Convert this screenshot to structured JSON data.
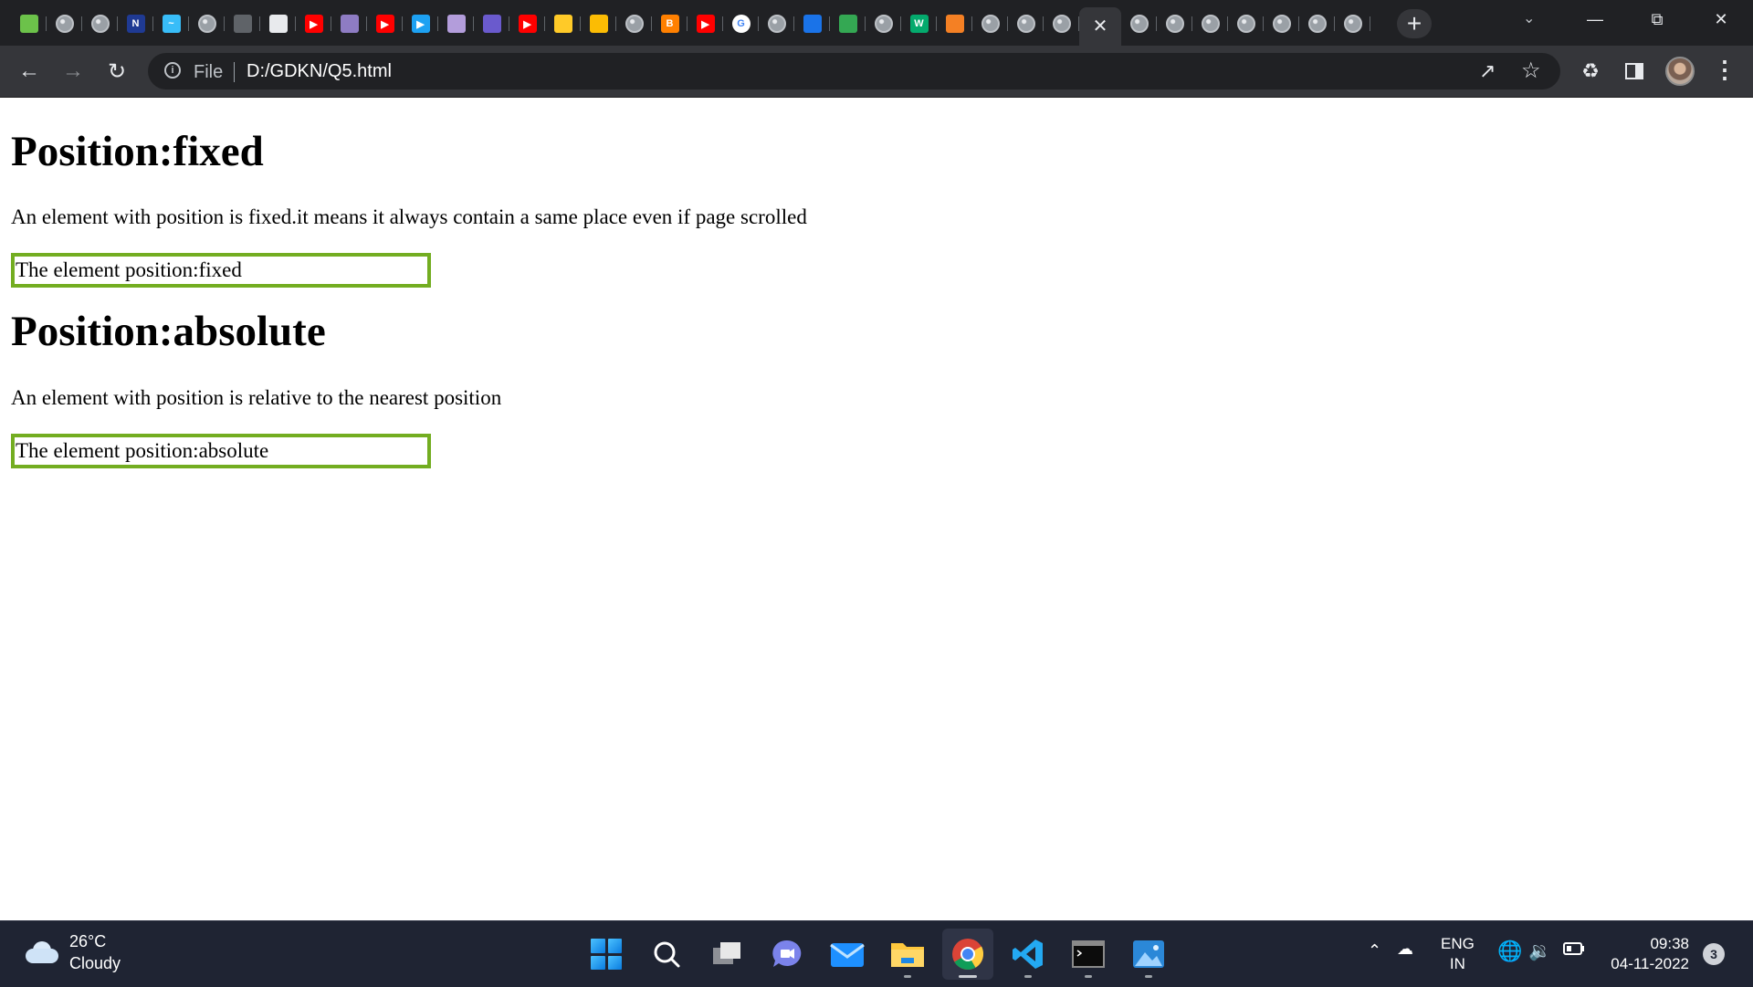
{
  "browser": {
    "tabs": [
      {
        "icon": "nodejs-icon",
        "color": "#6cc24a"
      },
      {
        "icon": "globe-icon"
      },
      {
        "icon": "globe-icon"
      },
      {
        "icon": "notion-icon",
        "color": "#1f3a93",
        "label": "N"
      },
      {
        "icon": "tailwind-icon",
        "color": "#38bdf8",
        "label": "~"
      },
      {
        "icon": "globe-icon"
      },
      {
        "icon": "book-icon",
        "color": "#5f6368"
      },
      {
        "icon": "codepen-icon",
        "color": "#e8eaed"
      },
      {
        "icon": "youtube-icon",
        "color": "#ff0000",
        "label": "▶"
      },
      {
        "icon": "github-copilot-icon",
        "color": "#8e7cc3"
      },
      {
        "icon": "youtube-icon",
        "color": "#ff0000",
        "label": "▶"
      },
      {
        "icon": "play-circle-icon",
        "color": "#1da1f2",
        "label": "▶"
      },
      {
        "icon": "orb-icon",
        "color": "#b39ddb"
      },
      {
        "icon": "meet-icon",
        "color": "#6a5acd"
      },
      {
        "icon": "youtube-icon",
        "color": "#ff0000",
        "label": "▶"
      },
      {
        "icon": "firebase-icon",
        "color": "#ffca28"
      },
      {
        "icon": "gemini-icon",
        "color": "#fbbc04"
      },
      {
        "icon": "globe-icon"
      },
      {
        "icon": "blogger-icon",
        "color": "#ff8000",
        "label": "B"
      },
      {
        "icon": "youtube-icon",
        "color": "#ff0000",
        "label": "▶"
      },
      {
        "icon": "google-icon",
        "color": "#ffffff",
        "label": "G"
      },
      {
        "icon": "globe-icon"
      },
      {
        "icon": "contacts-icon",
        "color": "#1a73e8"
      },
      {
        "icon": "google-drive-icon",
        "color": "#34a853"
      },
      {
        "icon": "globe-icon"
      },
      {
        "icon": "w3schools-icon",
        "color": "#04aa6d",
        "label": "W"
      },
      {
        "icon": "stackoverflow-icon",
        "color": "#f48024"
      },
      {
        "icon": "globe-icon"
      },
      {
        "icon": "globe-icon"
      },
      {
        "icon": "globe-icon"
      }
    ],
    "active_tab": {
      "icon": "close-icon",
      "label": "✕"
    },
    "tabs_after": [
      {
        "icon": "globe-icon"
      },
      {
        "icon": "globe-icon"
      },
      {
        "icon": "globe-icon"
      },
      {
        "icon": "globe-icon"
      },
      {
        "icon": "globe-icon"
      },
      {
        "icon": "globe-icon"
      },
      {
        "icon": "globe-icon"
      }
    ],
    "new_tab_label": "+",
    "address": {
      "scheme_label": "File",
      "url": "D:/GDKN/Q5.html"
    }
  },
  "page": {
    "sections": [
      {
        "heading": "Position:fixed",
        "description": "An element with position is fixed.it means it always contain a same place even if page scrolled",
        "box_text": "The element position:fixed"
      },
      {
        "heading": "Position:absolute",
        "description": "An element with position is relative to the nearest position",
        "box_text": "The element position:absolute"
      }
    ],
    "box_border_color": "#73ad21"
  },
  "taskbar": {
    "weather": {
      "temp": "26°C",
      "condition": "Cloudy"
    },
    "language": {
      "line1": "ENG",
      "line2": "IN"
    },
    "clock": {
      "time": "09:38",
      "date": "04-11-2022"
    },
    "notifications": "3"
  }
}
